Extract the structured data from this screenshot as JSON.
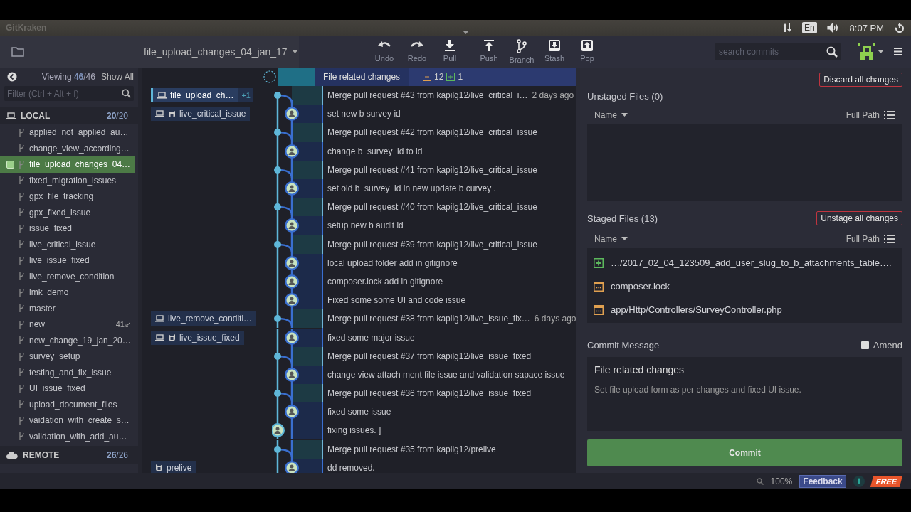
{
  "system_bar": {
    "title": "GitKraken",
    "keyboard": "En",
    "time": "8:07 PM"
  },
  "toolbar": {
    "branch": "file_upload_changes_04_jan_17",
    "buttons": [
      {
        "label": "Undo",
        "kind": "undo"
      },
      {
        "label": "Redo",
        "kind": "redo"
      },
      {
        "label": "Pull",
        "kind": "pull"
      },
      {
        "label": "Push",
        "kind": "push"
      },
      {
        "label": "Branch",
        "kind": "branch"
      },
      {
        "label": "Stash",
        "kind": "stash"
      },
      {
        "label": "Pop",
        "kind": "pop"
      }
    ],
    "search": {
      "placeholder": "search commits"
    }
  },
  "sidebar": {
    "viewing_label": "Viewing",
    "viewing_count": "46",
    "viewing_total": "/46",
    "show_all": "Show All",
    "filter": {
      "placeholder": "Filter (Ctrl + Alt + f)"
    },
    "local": {
      "title": "LOCAL",
      "count": "20",
      "total": "/20",
      "branches": [
        {
          "name": "applied_not_applied_au…",
          "selected": false
        },
        {
          "name": "change_view_according…",
          "selected": false
        },
        {
          "name": "file_upload_changes_04…",
          "selected": true
        },
        {
          "name": "fixed_migration_issues",
          "selected": false
        },
        {
          "name": "gpx_file_tracking",
          "selected": false
        },
        {
          "name": "gpx_fixed_issue",
          "selected": false
        },
        {
          "name": "issue_fixed",
          "selected": false
        },
        {
          "name": "live_critical_issue",
          "selected": false
        },
        {
          "name": "live_issue_fixed",
          "selected": false
        },
        {
          "name": "live_remove_condition",
          "selected": false
        },
        {
          "name": "lmk_demo",
          "selected": false
        },
        {
          "name": "master",
          "selected": false
        },
        {
          "name": "new",
          "selected": false,
          "badge": "41↙"
        },
        {
          "name": "new_change_19_jan_20…",
          "selected": false
        },
        {
          "name": "survey_setup",
          "selected": false
        },
        {
          "name": "testing_and_fix_issue",
          "selected": false
        },
        {
          "name": "UI_issue_fixed",
          "selected": false
        },
        {
          "name": "upload_document_files",
          "selected": false
        },
        {
          "name": "vaidation_with_create_s…",
          "selected": false
        },
        {
          "name": "validation_with_add_au…",
          "selected": false
        }
      ]
    },
    "remote": {
      "title": "REMOTE",
      "count": "26",
      "total": "/26"
    }
  },
  "graph": {
    "wip": {
      "summary": "File related changes",
      "modified": "12",
      "added": "1"
    },
    "commits": [
      {
        "message": "Merge pull request #43 from kapilg12/live_critical_i…",
        "kind": "merge",
        "time": "2 days ago",
        "refs": [
          {
            "name": "file_upload_ch…",
            "kind": "local",
            "selected": true,
            "extra": "+1"
          }
        ]
      },
      {
        "message": "set new b survey id",
        "kind": "commit",
        "refs": [
          {
            "name": "live_critical_issue",
            "kind": "both",
            "selected": false
          }
        ]
      },
      {
        "message": "Merge pull request #42 from kapilg12/live_critical_issue",
        "kind": "merge"
      },
      {
        "message": "change b_survey_id to id",
        "kind": "commit"
      },
      {
        "message": "Merge pull request #41 from kapilg12/live_critical_issue",
        "kind": "merge"
      },
      {
        "message": "set old b_survey_id in new update b curvey .",
        "kind": "commit"
      },
      {
        "message": "Merge pull request #40 from kapilg12/live_critical_issue",
        "kind": "merge"
      },
      {
        "message": "setup new b audit id",
        "kind": "commit"
      },
      {
        "message": "Merge pull request #39 from kapilg12/live_critical_issue",
        "kind": "merge"
      },
      {
        "message": "local upload folder add in gitignore",
        "kind": "commit"
      },
      {
        "message": "composer.lock add in gitignore",
        "kind": "commit"
      },
      {
        "message": "Fixed some some UI and code issue",
        "kind": "commit"
      },
      {
        "message": "Merge pull request #38 from kapilg12/live_issue_fix…",
        "kind": "merge",
        "time": "6 days ago",
        "refs": [
          {
            "name": "live_remove_conditi…",
            "kind": "local",
            "selected": false
          }
        ]
      },
      {
        "message": "fixed some major issue",
        "kind": "commit",
        "refs": [
          {
            "name": "live_issue_fixed",
            "kind": "both",
            "selected": false
          }
        ]
      },
      {
        "message": "Merge pull request #37 from kapilg12/live_issue_fixed",
        "kind": "merge"
      },
      {
        "message": "change view attach ment file issue and validation sapace issue",
        "kind": "commit"
      },
      {
        "message": "Merge pull request #36 from kapilg12/live_issue_fixed",
        "kind": "merge"
      },
      {
        "message": "fixed some issue",
        "kind": "commit"
      },
      {
        "message": "fixing issues. ]",
        "kind": "main-commit"
      },
      {
        "message": "Merge pull request #35 from kapilg12/prelive",
        "kind": "merge"
      },
      {
        "message": "dd removed.",
        "kind": "commit",
        "refs": [
          {
            "name": "prelive",
            "kind": "remote",
            "selected": false
          }
        ]
      }
    ]
  },
  "changes": {
    "discard_button": "Discard all changes",
    "unstaged": {
      "title": "Unstaged Files (0)",
      "sort": "Name",
      "path_toggle": "Full Path"
    },
    "staged": {
      "title": "Staged Files (13)",
      "button": "Unstage all changes",
      "sort": "Name",
      "path_toggle": "Full Path",
      "files": [
        {
          "path": "…/2017_02_04_123509_add_user_slug_to_b_attachments_table….",
          "kind": "added"
        },
        {
          "path": "composer.lock",
          "kind": "modified"
        },
        {
          "path": "app/Http/Controllers/SurveyController.php",
          "kind": "modified"
        }
      ]
    },
    "commit": {
      "label": "Commit Message",
      "amend": {
        "label": "Amend",
        "checked": false
      },
      "summary": "File related changes",
      "description": "Set file upload form as per changes and fixed UI issue.",
      "button": "Commit"
    }
  },
  "status_bar": {
    "zoom": "100%",
    "feedback": "Feedback",
    "plan": "FREE"
  }
}
